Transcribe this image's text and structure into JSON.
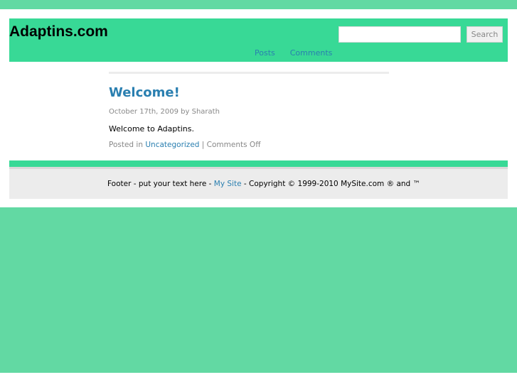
{
  "header": {
    "site_title": "Adaptins.com",
    "search": {
      "value": "",
      "placeholder": "",
      "button_label": "Search"
    },
    "nav": [
      {
        "label": "Posts"
      },
      {
        "label": "Comments"
      }
    ]
  },
  "post": {
    "title": "Welcome!",
    "meta": "October 17th, 2009 by Sharath",
    "body": "Welcome to Adaptins.",
    "posted_in_label": "Posted in",
    "category": "Uncategorized",
    "separator": " | ",
    "comments_status": "Comments Off"
  },
  "footer": {
    "prefix": "Footer - put your text here - ",
    "site_link": "My Site",
    "copyright": " - Copyright © 1999-2010 MySite.com ® and ™"
  },
  "colors": {
    "page_green": "#62d9a3",
    "header_green": "#38d996",
    "link_blue": "#2a7fb0",
    "footer_gray": "#ececec"
  }
}
